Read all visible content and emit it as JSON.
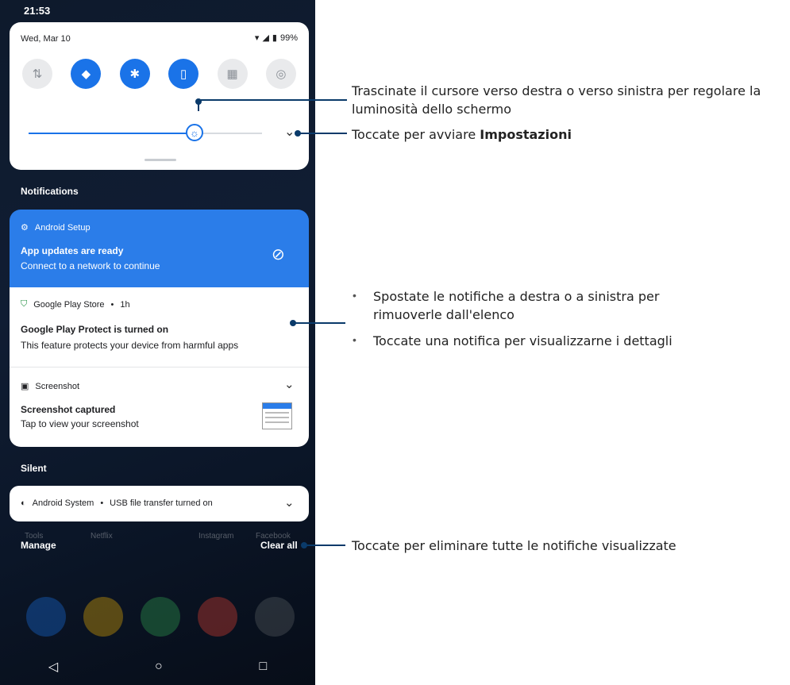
{
  "status_bar": {
    "time": "21:53"
  },
  "quick_settings": {
    "date": "Wed, Mar 10",
    "battery": "99%",
    "tiles": [
      {
        "icon": "mobile-data-icon",
        "glyph": "⇅",
        "active": false
      },
      {
        "icon": "wifi-icon",
        "glyph": "◆",
        "active": true
      },
      {
        "icon": "bluetooth-icon",
        "glyph": "✱",
        "active": true
      },
      {
        "icon": "vibrate-icon",
        "glyph": "▯",
        "active": true
      },
      {
        "icon": "qr-scanner-icon",
        "glyph": "▦",
        "active": false
      },
      {
        "icon": "nfc-icon",
        "glyph": "◎",
        "active": false
      }
    ],
    "brightness_level": 0.72
  },
  "notifications_header": "Notifications",
  "notifications": {
    "android_setup": {
      "app": "Android Setup",
      "title": "App updates are ready",
      "body": "Connect to a network to continue"
    },
    "play_store": {
      "app": "Google Play Store",
      "time": "1h",
      "title": "Google Play Protect is turned on",
      "body": "This feature protects your device from harmful apps"
    },
    "screenshot": {
      "app": "Screenshot",
      "title": "Screenshot captured",
      "body": "Tap to view your screenshot"
    }
  },
  "silent_header": "Silent",
  "silent": {
    "android_system": {
      "app": "Android System",
      "text": "USB file transfer turned on"
    }
  },
  "footer": {
    "manage": "Manage",
    "clear_all": "Clear all"
  },
  "home_labels": [
    "Tools",
    "Netflix",
    "Instagram",
    "Facebook"
  ],
  "annotations": {
    "brightness": "Trascinate il cursore verso destra o verso sinistra per regolare la luminosità dello schermo",
    "settings_prefix": "Toccate per avviare ",
    "settings_bold": "Impostazioni",
    "swipe": "Spostate le notifiche a destra o a sinistra per rimuoverle dall'elenco",
    "tap": "Toccate una notifica per visualizzarne i dettagli",
    "clear": "Toccate per eliminare tutte le notifiche visualizzate"
  },
  "colors": {
    "accent": "#1a73e8",
    "setup_card": "#2b7de9",
    "callout": "#0a3a6a"
  }
}
